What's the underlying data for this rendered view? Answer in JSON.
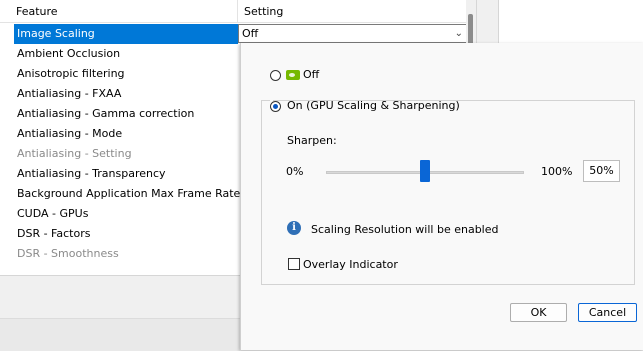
{
  "table": {
    "headers": {
      "feature": "Feature",
      "setting": "Setting"
    },
    "rows": [
      {
        "label": "Image Scaling",
        "state": "selected"
      },
      {
        "label": "Ambient Occlusion",
        "state": "normal"
      },
      {
        "label": "Anisotropic filtering",
        "state": "normal"
      },
      {
        "label": "Antialiasing - FXAA",
        "state": "normal"
      },
      {
        "label": "Antialiasing - Gamma correction",
        "state": "normal"
      },
      {
        "label": "Antialiasing - Mode",
        "state": "normal"
      },
      {
        "label": "Antialiasing - Setting",
        "state": "disabled"
      },
      {
        "label": "Antialiasing - Transparency",
        "state": "normal"
      },
      {
        "label": "Background Application Max Frame Rate",
        "state": "normal"
      },
      {
        "label": "CUDA - GPUs",
        "state": "normal"
      },
      {
        "label": "DSR - Factors",
        "state": "normal"
      },
      {
        "label": "DSR - Smoothness",
        "state": "disabled"
      }
    ],
    "selected_value": "Off",
    "dropdown_icon": "chevron-down-icon"
  },
  "popup": {
    "off_label": "Off",
    "off_icon": "nvidia-icon",
    "on_label": "On (GPU Scaling & Sharpening)",
    "selected_option": "on",
    "sharpen_label": "Sharpen:",
    "min_label": "0%",
    "max_label": "100%",
    "sharpen_value_text": "50%",
    "sharpen_value": 50,
    "info_icon": "info-icon",
    "info_text": "Scaling Resolution will be enabled",
    "overlay_label": "Overlay Indicator",
    "overlay_checked": false,
    "ok_label": "OK",
    "cancel_label": "Cancel"
  },
  "colors": {
    "selection": "#0078d7",
    "accent": "#0a66d6",
    "nvidia_green": "#76b900"
  }
}
